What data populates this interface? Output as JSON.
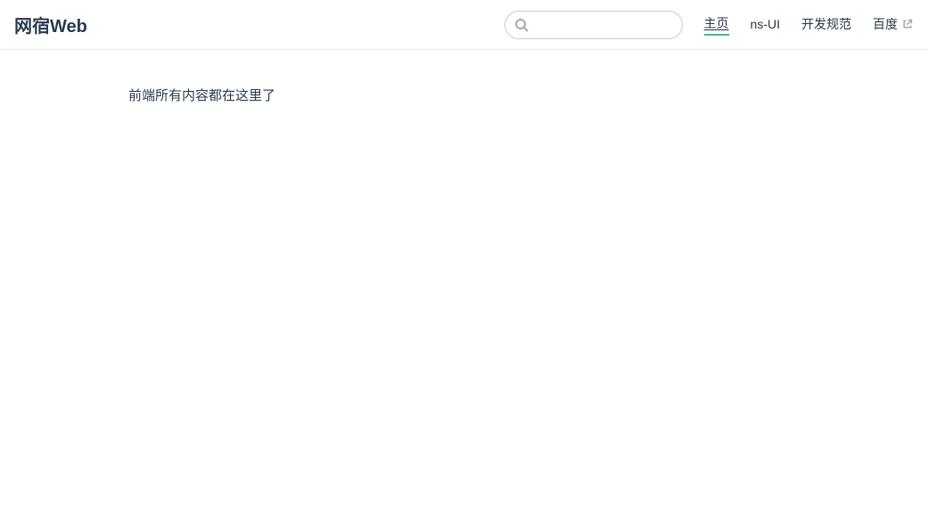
{
  "header": {
    "brand": "网宿Web",
    "search": {
      "value": "",
      "placeholder": ""
    },
    "nav": {
      "items": [
        {
          "label": "主页",
          "active": true,
          "external": false
        },
        {
          "label": "ns-UI",
          "active": false,
          "external": false
        },
        {
          "label": "开发规范",
          "active": false,
          "external": false
        },
        {
          "label": "百度",
          "active": false,
          "external": true
        }
      ]
    }
  },
  "main": {
    "intro": "前端所有内容都在这里了"
  }
}
